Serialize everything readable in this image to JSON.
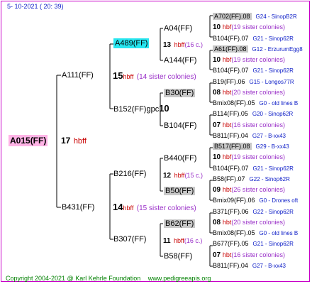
{
  "date": "5- 10-2021 ( 20: 39)",
  "common": {
    "hbff": "hbff"
  },
  "root": {
    "name": "A015(FF)",
    "year": "17",
    "hbff": "hbff"
  },
  "l1": {
    "a111": "A111(FF)",
    "a111_year": "15",
    "a111_sis": "(14 sister colonies)",
    "b431": "B431(FF)",
    "b431_year": "14",
    "b431_sis": "(15 sister colonies)"
  },
  "l2": {
    "a489": "A489(FF)",
    "a489_year": "13",
    "a489_sis": "(16 c.)",
    "b152": "B152(FF)gpc",
    "b152_year": "10",
    "b216": "B216(FF)",
    "b216_year": "12",
    "b216_sis": "(15 c.)",
    "b307": "B307(FF)",
    "b307_year": "11",
    "b307_sis": "(16 c.)"
  },
  "l3": {
    "a04": "A04(FF)",
    "a144": "A144(FF)",
    "b30": "B30(FF)",
    "b30_year": "",
    "b104": "B104(FF)",
    "b440": "B440(FF)",
    "b50": "B50(FF)",
    "b62": "B62(FF)",
    "b58": "B58(FF)"
  },
  "l4": [
    {
      "name": "A702(FF).08",
      "grey": true,
      "tag": "G24 - SinopB2R"
    },
    {
      "year": "10",
      "hb": "hbf",
      "sis": "(19 sister colonies)"
    },
    {
      "name": "B104(FF).07",
      "tag": "G21 - Sinop62R"
    },
    {
      "name": "A61(FF).08",
      "grey": true,
      "tag": "G12 - ErzurumEgg8"
    },
    {
      "year": "10",
      "hb": "hbf",
      "sis": "(19 sister colonies)"
    },
    {
      "name": "B104(FF).07",
      "tag": "G21 - Sinop62R"
    },
    {
      "name": "B19(FF).06",
      "tag": "G15 - Longos77R"
    },
    {
      "year": "08",
      "hb": "hbt",
      "sis": "(20 sister colonies)"
    },
    {
      "name": "Bmix08(FF).05",
      "tag": "G0 - old lines B"
    },
    {
      "name": "B114(FF).05",
      "tag": "G20 - Sinop62R"
    },
    {
      "year": "07",
      "hb": "hbt",
      "sis": "(16 sister colonies)"
    },
    {
      "name": "B811(FF).04",
      "tag": "G27 - B-xx43"
    },
    {
      "name": "B517(FF).08",
      "grey": true,
      "tag": "G29 - B-xx43"
    },
    {
      "year": "10",
      "hb": "hbf",
      "sis": "(19 sister colonies)"
    },
    {
      "name": "B104(FF).07",
      "tag": "G21 - Sinop62R"
    },
    {
      "name": "B58(FF).07",
      "tag": "G22 - Sinop62R"
    },
    {
      "year": "09",
      "hb": "hbt",
      "sis": "(26 sister colonies)"
    },
    {
      "name": "Bmix09(FF).06",
      "tag": "G0 - Drones oft"
    },
    {
      "name": "B371(FF).06",
      "tag": "G22 - Sinop62R"
    },
    {
      "year": "08",
      "hb": "hbt",
      "sis": "(20 sister colonies)"
    },
    {
      "name": "Bmix08(FF).05",
      "tag": "G0 - old lines B"
    },
    {
      "name": "B677(FF).05",
      "tag": "G21 - Sinop62R"
    },
    {
      "year": "07",
      "hb": "hbt",
      "sis": "(16 sister colonies)"
    },
    {
      "name": "B811(FF).04",
      "tag": "G27 - B-xx43"
    }
  ],
  "footer": {
    "copyright": "Copyright 2004-2021 @ Karl Kehrle Foundation",
    "site": "www.pedigreeapis.org"
  }
}
